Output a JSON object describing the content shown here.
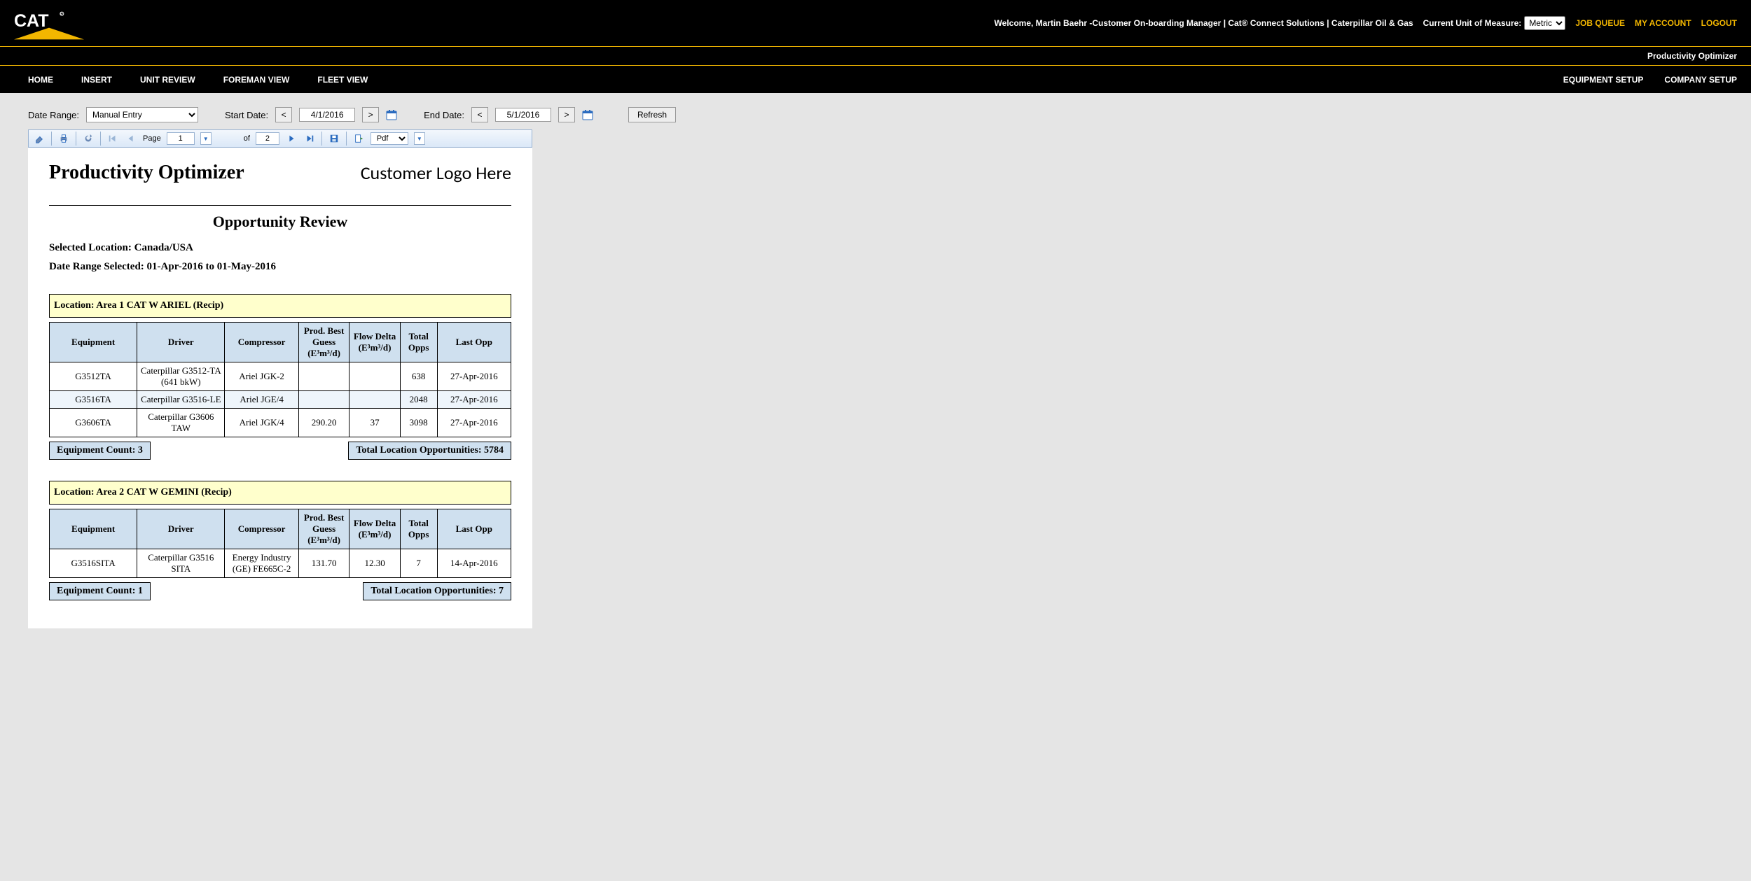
{
  "header": {
    "welcome_text": "Welcome, Martin Baehr -Customer On-boarding Manager | Cat® Connect Solutions | Caterpillar Oil & Gas",
    "uom_label": "Current Unit of Measure:",
    "uom_value": "Metric",
    "job_queue": "JOB QUEUE",
    "my_account": "MY ACCOUNT",
    "logout": "LOGOUT",
    "subtitle": "Productivity Optimizer"
  },
  "nav": {
    "left": [
      "HOME",
      "INSERT",
      "UNIT REVIEW",
      "FOREMAN VIEW",
      "FLEET VIEW"
    ],
    "right": [
      "EQUIPMENT SETUP",
      "COMPANY SETUP"
    ]
  },
  "controls": {
    "date_range_label": "Date Range:",
    "date_range_value": "Manual Entry",
    "start_label": "Start Date:",
    "start_value": "4/1/2016",
    "end_label": "End Date:",
    "end_value": "5/1/2016",
    "refresh": "Refresh"
  },
  "viewer_toolbar": {
    "page_label": "Page",
    "page_current": "1",
    "of_label": "of",
    "page_total": "2",
    "export_format": "Pdf"
  },
  "report": {
    "title": "Productivity Optimizer",
    "customer_logo": "Customer Logo Here",
    "section_heading": "Opportunity Review",
    "selected_location_label": "Selected Location: Canada/USA",
    "date_range_label": "Date Range Selected: 01-Apr-2016 to 01-May-2016",
    "columns": [
      "Equipment",
      "Driver",
      "Compressor",
      "Prod. Best Guess (E³m³/d)",
      "Flow Delta (E³m³/d)",
      "Total Opps",
      "Last Opp"
    ],
    "locations": [
      {
        "header": "Location: Area 1 CAT W ARIEL (Recip)",
        "rows": [
          {
            "equipment": "G3512TA",
            "driver": "Caterpillar G3512-TA (641 bkW)",
            "compressor": "Ariel JGK-2",
            "guess": "",
            "delta": "",
            "opps": "638",
            "last": "27-Apr-2016"
          },
          {
            "equipment": "G3516TA",
            "driver": "Caterpillar G3516-LE",
            "compressor": "Ariel JGE/4",
            "guess": "",
            "delta": "",
            "opps": "2048",
            "last": "27-Apr-2016"
          },
          {
            "equipment": "G3606TA",
            "driver": "Caterpillar G3606 TAW",
            "compressor": "Ariel JGK/4",
            "guess": "290.20",
            "delta": "37",
            "opps": "3098",
            "last": "27-Apr-2016"
          }
        ],
        "equipment_count": "Equipment Count: 3",
        "total_opps": "Total Location Opportunities: 5784"
      },
      {
        "header": "Location: Area 2 CAT W GEMINI (Recip)",
        "rows": [
          {
            "equipment": "G3516SITA",
            "driver": "Caterpillar G3516 SITA",
            "compressor": "Energy Industry (GE) FE665C-2",
            "guess": "131.70",
            "delta": "12.30",
            "opps": "7",
            "last": "14-Apr-2016"
          }
        ],
        "equipment_count": "Equipment Count: 1",
        "total_opps": "Total Location Opportunities: 7"
      }
    ]
  }
}
